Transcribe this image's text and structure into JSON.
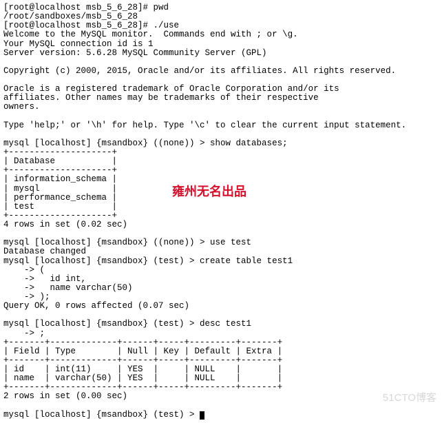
{
  "lines": {
    "l00": "[root@localhost msb_5_6_28]# pwd",
    "l01": "/root/sandboxes/msb_5_6_28",
    "l02": "[root@localhost msb_5_6_28]# ./use",
    "l03": "Welcome to the MySQL monitor.  Commands end with ; or \\g.",
    "l04": "Your MySQL connection id is 1",
    "l05": "Server version: 5.6.28 MySQL Community Server (GPL)",
    "l06": "",
    "l07": "Copyright (c) 2000, 2015, Oracle and/or its affiliates. All rights reserved.",
    "l08": "",
    "l09": "Oracle is a registered trademark of Oracle Corporation and/or its",
    "l10": "affiliates. Other names may be trademarks of their respective",
    "l11": "owners.",
    "l12": "",
    "l13": "Type 'help;' or '\\h' for help. Type '\\c' to clear the current input statement.",
    "l14": "",
    "l15": "mysql [localhost] {msandbox} ((none)) > show databases;",
    "l16": "+--------------------+",
    "l17": "| Database           |",
    "l18": "+--------------------+",
    "l19": "| information_schema |",
    "l20": "| mysql              |",
    "l21": "| performance_schema |",
    "l22": "| test               |",
    "l23": "+--------------------+",
    "l24": "4 rows in set (0.02 sec)",
    "l25": "",
    "l26": "mysql [localhost] {msandbox} ((none)) > use test",
    "l27": "Database changed",
    "l28": "mysql [localhost] {msandbox} (test) > create table test1",
    "l29": "    -> (",
    "l30": "    ->   id int,",
    "l31": "    ->   name varchar(50)",
    "l32": "    -> );",
    "l33": "Query OK, 0 rows affected (0.07 sec)",
    "l34": "",
    "l35": "mysql [localhost] {msandbox} (test) > desc test1",
    "l36": "    -> ;",
    "l37": "+-------+-------------+------+-----+---------+-------+",
    "l38": "| Field | Type        | Null | Key | Default | Extra |",
    "l39": "+-------+-------------+------+-----+---------+-------+",
    "l40": "| id    | int(11)     | YES  |     | NULL    |       |",
    "l41": "| name  | varchar(50) | YES  |     | NULL    |       |",
    "l42": "+-------+-------------+------+-----+---------+-------+",
    "l43": "2 rows in set (0.00 sec)",
    "l44": "",
    "l45": "mysql [localhost] {msandbox} (test) > "
  },
  "overlay_text": "雍州无名出品",
  "watermark": "51CTO博客"
}
